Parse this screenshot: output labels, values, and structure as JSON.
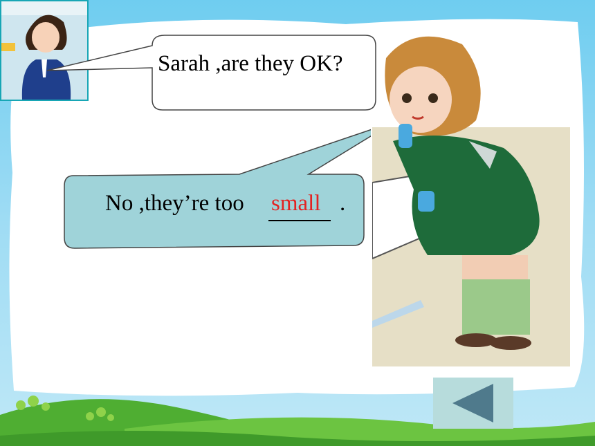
{
  "bubble1": {
    "text": "Sarah ,are they OK?"
  },
  "bubble2": {
    "text": "No ,they’re too",
    "answer": "small",
    "period": "."
  },
  "nav": {
    "back_icon": "triangle-left-icon"
  },
  "colors": {
    "sky": "#6fcdf0",
    "grass": "#56b83a",
    "bubble2_fill": "#9fd3d9",
    "answer": "#e32222",
    "back_button": "#b7dcdc",
    "back_arrow": "#4f7a8c"
  }
}
